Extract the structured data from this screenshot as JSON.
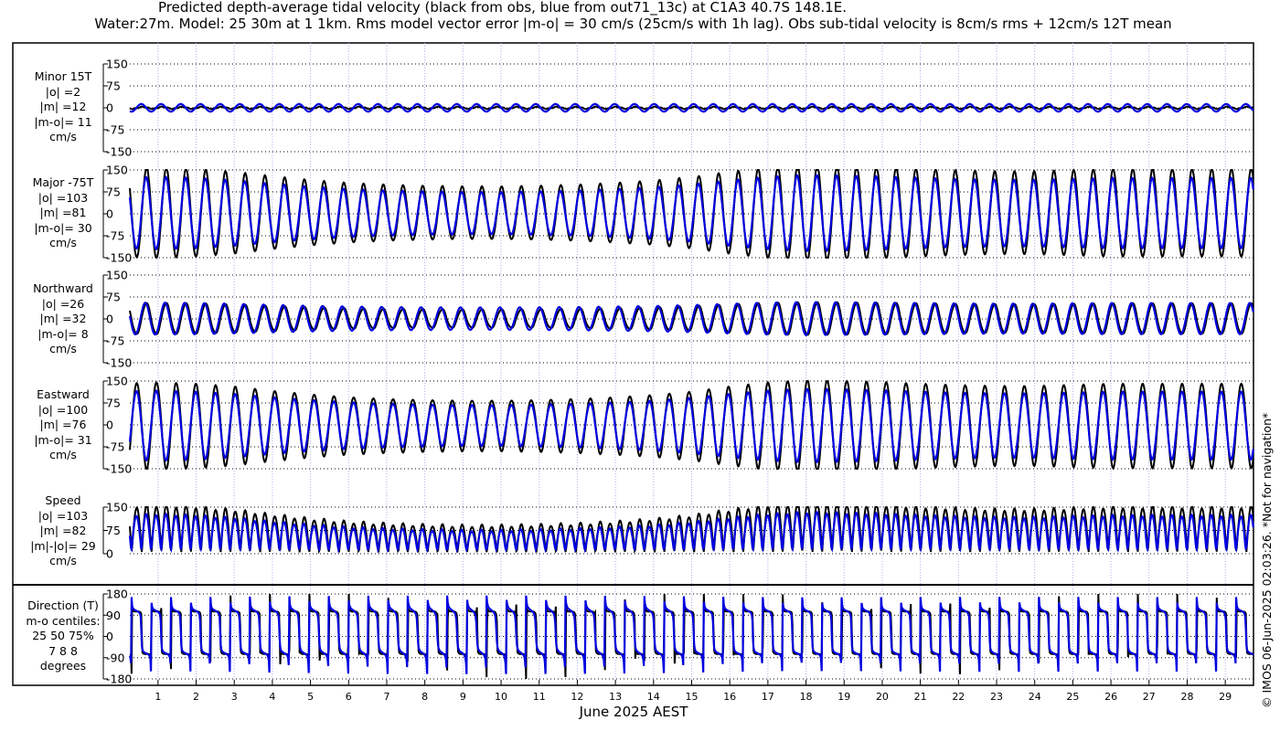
{
  "title_line1": "Predicted depth-average tidal velocity (black from obs, blue from out71_13c) at C1A3 40.7S 148.1E.",
  "title_line2": "Water:27m. Model: 25 30m at 1 1km. Rms model vector error |m-o| = 30 cm/s (25cm/s with 1h lag). Obs sub-tidal velocity is 8cm/s rms + 12cm/s 12T mean",
  "copyright": "© IMOS 06-Jun-2025 02:03:26. *Not for navigation*",
  "colors": {
    "obs": "#000000",
    "model": "#0000e0",
    "vgrid": "#aab4e8"
  },
  "chart_data": {
    "type": "line",
    "xlabel": "June 2025 AEST",
    "xlim": [
      0.26,
      29.74
    ],
    "xticks": [
      1,
      2,
      3,
      4,
      5,
      6,
      7,
      8,
      9,
      10,
      11,
      12,
      13,
      14,
      15,
      16,
      17,
      18,
      19,
      20,
      21,
      22,
      23,
      24,
      25,
      26,
      27,
      28,
      29
    ],
    "tide_period_days": 0.5175,
    "major_amplitude_by_day": {
      "days": [
        0,
        1,
        2,
        3,
        4,
        5,
        6,
        7,
        8,
        9,
        10,
        11,
        12,
        13,
        14,
        15,
        16,
        17,
        18,
        19,
        20,
        21,
        22,
        23,
        24,
        25,
        26,
        27,
        28,
        29,
        30
      ],
      "obs": [
        150,
        155,
        150,
        140,
        125,
        112,
        102,
        96,
        92,
        90,
        90,
        92,
        96,
        102,
        110,
        122,
        140,
        155,
        162,
        160,
        156,
        150,
        145,
        142,
        142,
        146,
        150,
        150,
        150,
        150,
        150
      ],
      "model": [
        120,
        124,
        120,
        112,
        100,
        90,
        82,
        77,
        74,
        72,
        72,
        74,
        77,
        82,
        88,
        98,
        112,
        124,
        130,
        128,
        125,
        120,
        116,
        114,
        114,
        117,
        120,
        120,
        120,
        120,
        120
      ]
    },
    "series_names": [
      "obs",
      "model"
    ],
    "panels": [
      {
        "id": "minor",
        "label": [
          "Minor 15T",
          "|o| =2",
          "|m| =12",
          "|m-o|= 11",
          "cm/s"
        ],
        "ylim": [
          -150,
          150
        ],
        "yticks": [
          "150",
          "75",
          "0",
          "-75",
          "-150"
        ]
      },
      {
        "id": "major",
        "label": [
          "Major -75T",
          "|o| =103",
          "|m| =81",
          "|m-o|= 30",
          "cm/s"
        ],
        "ylim": [
          -150,
          150
        ],
        "yticks": [
          "150",
          "75",
          "0",
          "-75",
          "-150"
        ]
      },
      {
        "id": "north",
        "label": [
          "Northward",
          "|o| =26",
          "|m| =32",
          "|m-o|= 8",
          "cm/s"
        ],
        "ylim": [
          -150,
          150
        ],
        "yticks": [
          "150",
          "75",
          "0",
          "-75",
          "-150"
        ]
      },
      {
        "id": "east",
        "label": [
          "Eastward",
          "|o| =100",
          "|m| =76",
          "|m-o|= 31",
          "cm/s"
        ],
        "ylim": [
          -150,
          150
        ],
        "yticks": [
          "150",
          "75",
          "0",
          "-75",
          "-150"
        ]
      },
      {
        "id": "speed",
        "label": [
          "Speed",
          "|o| =103",
          "|m| =82",
          "|m|-|o|= 29",
          "cm/s"
        ],
        "ylim": [
          0,
          150
        ],
        "yticks": [
          "150",
          "75",
          "0"
        ]
      },
      {
        "id": "dir",
        "label": [
          "Direction (T)",
          "m-o centiles:",
          "25  50  75%",
          "7  8  8",
          "degrees"
        ],
        "ylim": [
          -180,
          180
        ],
        "yticks": [
          "180",
          "90",
          "0",
          "-90",
          "-180"
        ]
      }
    ]
  }
}
